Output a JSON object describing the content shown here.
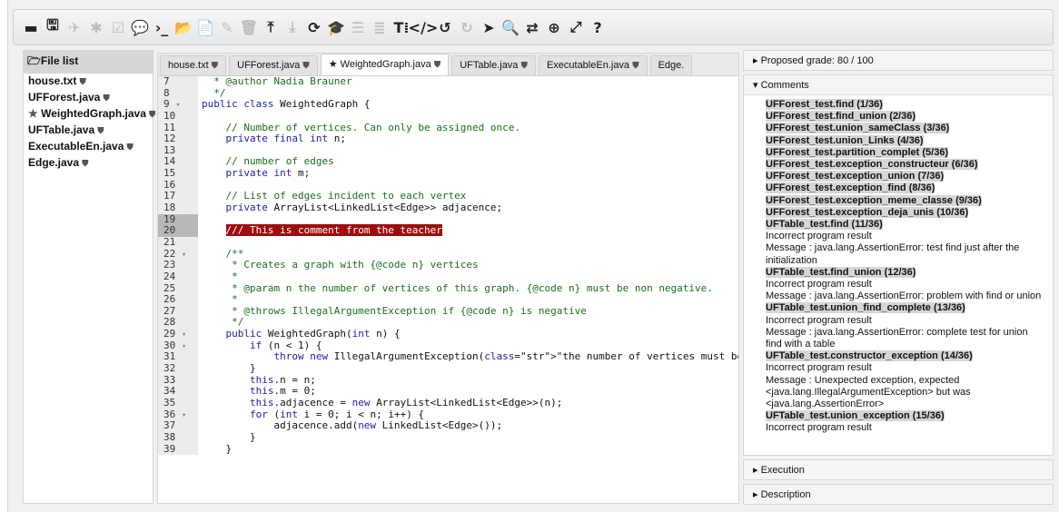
{
  "toolbar": {
    "buttons": [
      {
        "name": "minimize-button",
        "glyph": "▬",
        "dim": false
      },
      {
        "name": "save-button",
        "glyph": "🖫",
        "dim": false
      },
      {
        "name": "rocket-button",
        "glyph": "✈",
        "dim": true
      },
      {
        "name": "bug-button",
        "glyph": "✱",
        "dim": true
      },
      {
        "name": "check-button",
        "glyph": "☑",
        "dim": true
      },
      {
        "name": "comment-button",
        "glyph": "💬",
        "dim": false
      },
      {
        "name": "terminal-button",
        "glyph": "›_",
        "dim": false
      },
      {
        "name": "open-folder-button",
        "glyph": "📂",
        "dim": false
      },
      {
        "name": "new-file-button",
        "glyph": "📄",
        "dim": false
      },
      {
        "name": "edit-button",
        "glyph": "✎",
        "dim": true
      },
      {
        "name": "delete-button",
        "glyph": "🗑",
        "dim": true
      },
      {
        "name": "upload-button",
        "glyph": "⤒",
        "dim": false
      },
      {
        "name": "download-button",
        "glyph": "⤓",
        "dim": true
      },
      {
        "name": "refresh-button",
        "glyph": "⟳",
        "dim": false
      },
      {
        "name": "graduate-button",
        "glyph": "🎓",
        "dim": false
      },
      {
        "name": "list-button",
        "glyph": "☰",
        "dim": true
      },
      {
        "name": "trash-list-button",
        "glyph": "≣",
        "dim": true
      },
      {
        "name": "text-size-button",
        "glyph": "T⁞",
        "dim": false
      },
      {
        "name": "code-button",
        "glyph": "</>",
        "dim": false
      },
      {
        "name": "undo-button",
        "glyph": "↺",
        "dim": false
      },
      {
        "name": "redo-button",
        "glyph": "↻",
        "dim": true
      },
      {
        "name": "pointer-button",
        "glyph": "➤",
        "dim": false
      },
      {
        "name": "search-button",
        "glyph": "🔍",
        "dim": false
      },
      {
        "name": "swap-button",
        "glyph": "⇄",
        "dim": false
      },
      {
        "name": "zoom-button",
        "glyph": "⊕",
        "dim": false
      },
      {
        "name": "expand-button",
        "glyph": "⤢",
        "dim": false
      },
      {
        "name": "help-button",
        "glyph": "?",
        "dim": false
      }
    ]
  },
  "filelist": {
    "header": "File list",
    "items": [
      "house.txt",
      "UFForest.java",
      "WeightedGraph.java",
      "UFTable.java",
      "ExecutableEn.java",
      "Edge.java"
    ]
  },
  "tabs": [
    "house.txt",
    "UFForest.java",
    "WeightedGraph.java",
    "UFTable.java",
    "ExecutableEn.java",
    "Edge."
  ],
  "code_lines": [
    {
      "n": "7",
      "t": "  * @author Nadia Brauner",
      "fold": false
    },
    {
      "n": "8",
      "t": "  */",
      "fold": false
    },
    {
      "n": "9",
      "t": "public class WeightedGraph {",
      "fold": true
    },
    {
      "n": "10",
      "t": "",
      "fold": false
    },
    {
      "n": "11",
      "t": "    // Number of vertices. Can only be assigned once.",
      "fold": false
    },
    {
      "n": "12",
      "t": "    private final int n;",
      "fold": false
    },
    {
      "n": "13",
      "t": "",
      "fold": false
    },
    {
      "n": "14",
      "t": "    // number of edges",
      "fold": false
    },
    {
      "n": "15",
      "t": "    private int m;",
      "fold": false
    },
    {
      "n": "16",
      "t": "",
      "fold": false
    },
    {
      "n": "17",
      "t": "    // List of edges incident to each vertex",
      "fold": false
    },
    {
      "n": "18",
      "t": "    private ArrayList<LinkedList<Edge>> adjacence;",
      "fold": false
    },
    {
      "n": "19",
      "t": "",
      "fold": false
    },
    {
      "n": "20",
      "t": "    /// This is comment from the teacher",
      "fold": false
    },
    {
      "n": "21",
      "t": "",
      "fold": false
    },
    {
      "n": "22",
      "t": "    /**",
      "fold": true
    },
    {
      "n": "23",
      "t": "     * Creates a graph with {@code n} vertices",
      "fold": false
    },
    {
      "n": "24",
      "t": "     *",
      "fold": false
    },
    {
      "n": "25",
      "t": "     * @param n the number of vertices of this graph. {@code n} must be non negative.",
      "fold": false
    },
    {
      "n": "26",
      "t": "     *",
      "fold": false
    },
    {
      "n": "27",
      "t": "     * @throws IllegalArgumentException if {@code n} is negative",
      "fold": false
    },
    {
      "n": "28",
      "t": "     */",
      "fold": false
    },
    {
      "n": "29",
      "t": "    public WeightedGraph(int n) {",
      "fold": true
    },
    {
      "n": "30",
      "t": "        if (n < 1) {",
      "fold": true
    },
    {
      "n": "31",
      "t": "            throw new IllegalArgumentException(\"the number of vertices must be non negative\");",
      "fold": false
    },
    {
      "n": "32",
      "t": "        }",
      "fold": false
    },
    {
      "n": "33",
      "t": "        this.n = n;",
      "fold": false
    },
    {
      "n": "34",
      "t": "        this.m = 0;",
      "fold": false
    },
    {
      "n": "35",
      "t": "        this.adjacence = new ArrayList<LinkedList<Edge>>(n);",
      "fold": false
    },
    {
      "n": "36",
      "t": "        for (int i = 0; i < n; i++) {",
      "fold": true
    },
    {
      "n": "37",
      "t": "            adjacence.add(new LinkedList<Edge>());",
      "fold": false
    },
    {
      "n": "38",
      "t": "        }",
      "fold": false
    },
    {
      "n": "39",
      "t": "    }",
      "fold": false
    }
  ],
  "right": {
    "grade": "Proposed grade: 80 / 100",
    "comments_title": "Comments",
    "comments": [
      {
        "test": "UFForest_test.find (1/36)",
        "lines": []
      },
      {
        "test": "UFForest_test.find_union (2/36)",
        "lines": []
      },
      {
        "test": "UFForest_test.union_sameClass (3/36)",
        "lines": []
      },
      {
        "test": "UFForest_test.union_Links (4/36)",
        "lines": []
      },
      {
        "test": "UFForest_test.partition_complet (5/36)",
        "lines": []
      },
      {
        "test": "UFForest_test.exception_constructeur (6/36)",
        "lines": []
      },
      {
        "test": "UFForest_test.exception_union (7/36)",
        "lines": []
      },
      {
        "test": "UFForest_test.exception_find (8/36)",
        "lines": []
      },
      {
        "test": "UFForest_test.exception_meme_classe (9/36)",
        "lines": []
      },
      {
        "test": "UFForest_test.exception_deja_unis (10/36)",
        "lines": []
      },
      {
        "test": "UFTable_test.find (11/36)",
        "lines": [
          "Incorrect program result",
          "Message : java.lang.AssertionError: test find just after the initialization"
        ]
      },
      {
        "test": "UFTable_test.find_union (12/36)",
        "lines": [
          "Incorrect program result",
          "Message : java.lang.AssertionError: problem with find or union"
        ]
      },
      {
        "test": "UFTable_test.union_find_complete (13/36)",
        "lines": [
          "Incorrect program result",
          "Message : java.lang.AssertionError: complete test for union find with a table"
        ]
      },
      {
        "test": "UFTable_test.constructor_exception (14/36)",
        "lines": [
          "Incorrect program result",
          "Message : Unexpected exception, expected <java.lang.IllegalArgumentException> but was <java.lang.AssertionError>"
        ]
      },
      {
        "test": "UFTable_test.union_exception (15/36)",
        "lines": [
          "Incorrect program result"
        ]
      }
    ],
    "execution": "Execution",
    "description": "Description"
  }
}
